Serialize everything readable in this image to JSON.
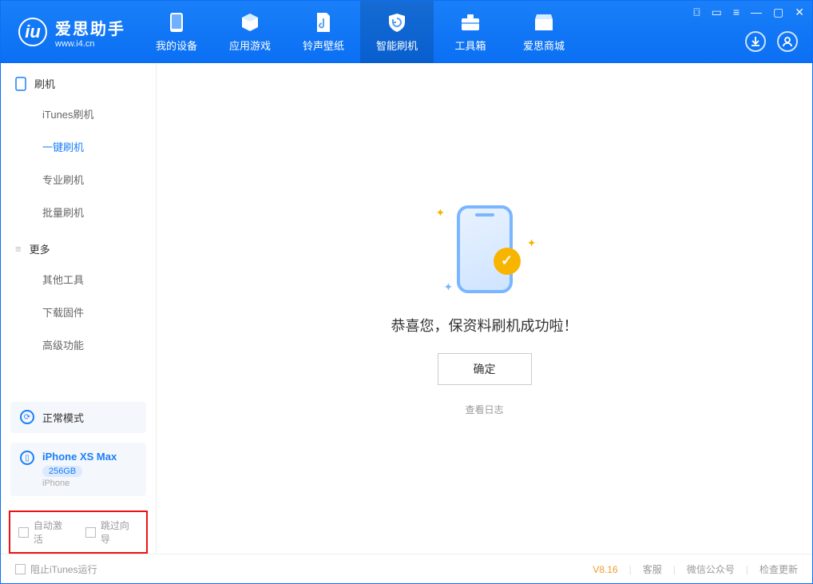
{
  "app": {
    "name": "爱思助手",
    "url": "www.i4.cn"
  },
  "nav": {
    "items": [
      {
        "label": "我的设备"
      },
      {
        "label": "应用游戏"
      },
      {
        "label": "铃声壁纸"
      },
      {
        "label": "智能刷机"
      },
      {
        "label": "工具箱"
      },
      {
        "label": "爱思商城"
      }
    ],
    "active_index": 3
  },
  "sidebar": {
    "section1": {
      "title": "刷机",
      "items": [
        "iTunes刷机",
        "一键刷机",
        "专业刷机",
        "批量刷机"
      ],
      "active_index": 1
    },
    "section2": {
      "title": "更多",
      "items": [
        "其他工具",
        "下载固件",
        "高级功能"
      ]
    },
    "mode": {
      "label": "正常模式"
    },
    "device": {
      "name": "iPhone XS Max",
      "capacity": "256GB",
      "type": "iPhone"
    },
    "checkboxes": {
      "auto_activate": "自动激活",
      "skip_guide": "跳过向导"
    }
  },
  "main": {
    "success_message": "恭喜您，保资料刷机成功啦！",
    "confirm_label": "确定",
    "view_log_label": "查看日志"
  },
  "footer": {
    "block_itunes": "阻止iTunes运行",
    "version": "V8.16",
    "links": [
      "客服",
      "微信公众号",
      "检查更新"
    ]
  }
}
